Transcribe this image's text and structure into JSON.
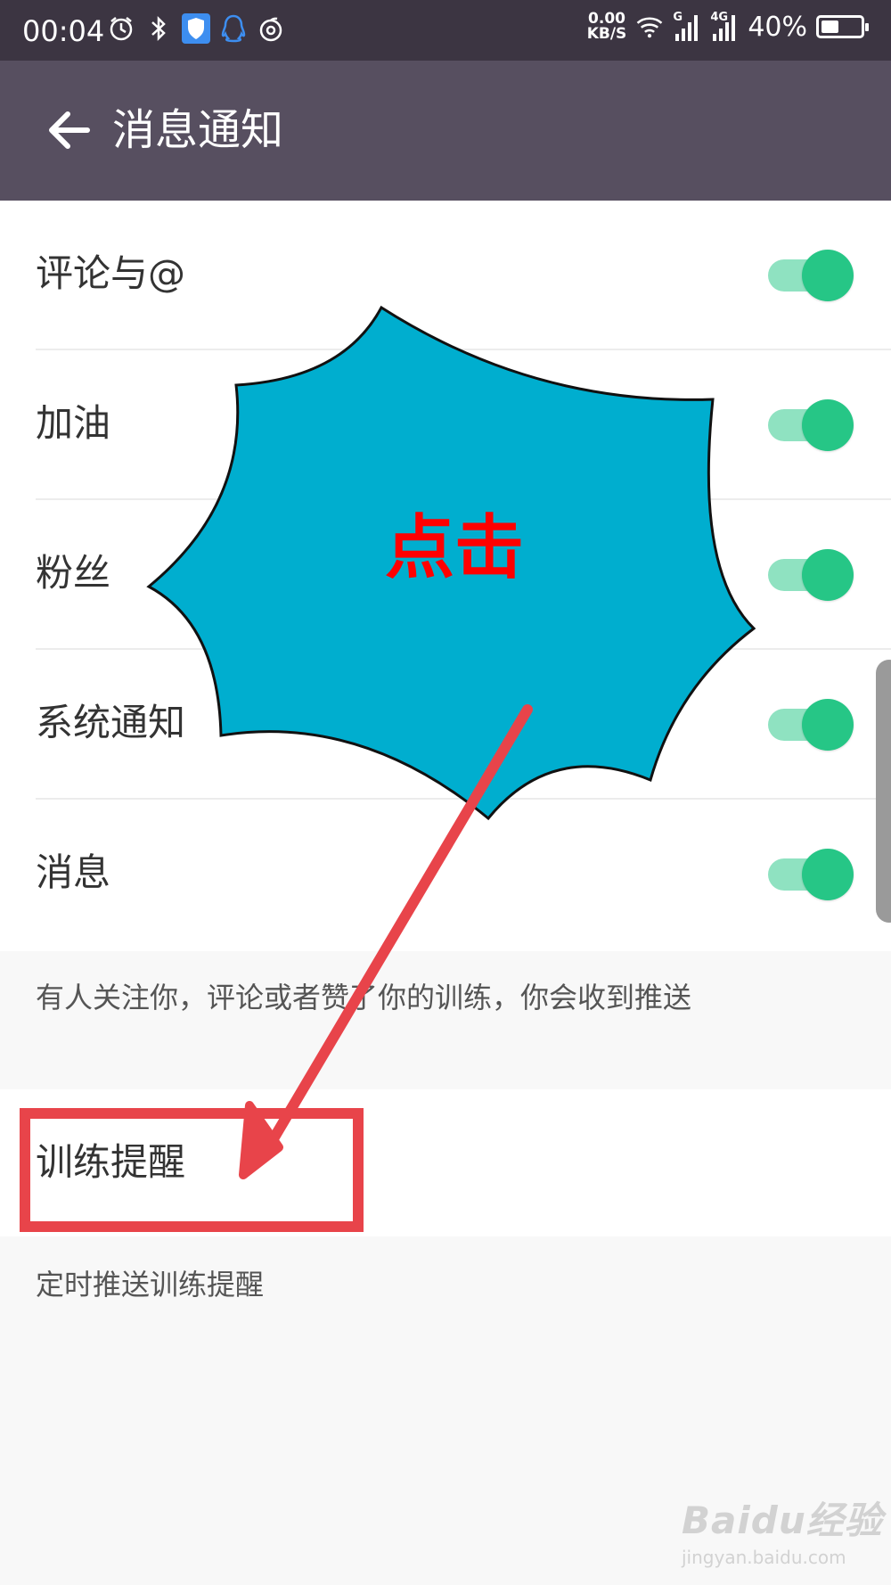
{
  "status_bar": {
    "time": "00:04",
    "speed_value": "0.00",
    "speed_unit": "KB/S",
    "network_g": "G",
    "network_4g": "4G",
    "battery": "40%",
    "battery_level": 0.4,
    "left_icons": [
      "alarm-icon",
      "bluetooth-icon",
      "shield-icon",
      "qq-icon",
      "netease-icon"
    ],
    "right_icons": [
      "wifi-icon",
      "signal-icon",
      "signal-4g-icon",
      "battery-icon"
    ]
  },
  "header": {
    "title": "消息通知",
    "back_icon": "arrow-left-icon"
  },
  "notifications": [
    {
      "label": "评论与@",
      "enabled": true
    },
    {
      "label": "加油",
      "enabled": true
    },
    {
      "label": "粉丝",
      "enabled": true
    },
    {
      "label": "系统通知",
      "enabled": true
    },
    {
      "label": "消息",
      "enabled": true
    }
  ],
  "hint_text": "有人关注你，评论或者赞了你的训练，你会收到推送",
  "training": {
    "label": "训练提醒",
    "hint": "定时推送训练提醒"
  },
  "annotation": {
    "callout_text": "点击",
    "callout_color": "#00aecf",
    "text_color": "#ff0000",
    "arrow_color": "#e8444a",
    "box_color": "#e8444a"
  },
  "watermark": {
    "main": "Baidu经验",
    "sub": "jingyan.baidu.com"
  },
  "colors": {
    "status_bar": "#3c3542",
    "app_bar": "#574f60",
    "toggle_track": "#8fe2c1",
    "toggle_knob": "#26c686"
  }
}
